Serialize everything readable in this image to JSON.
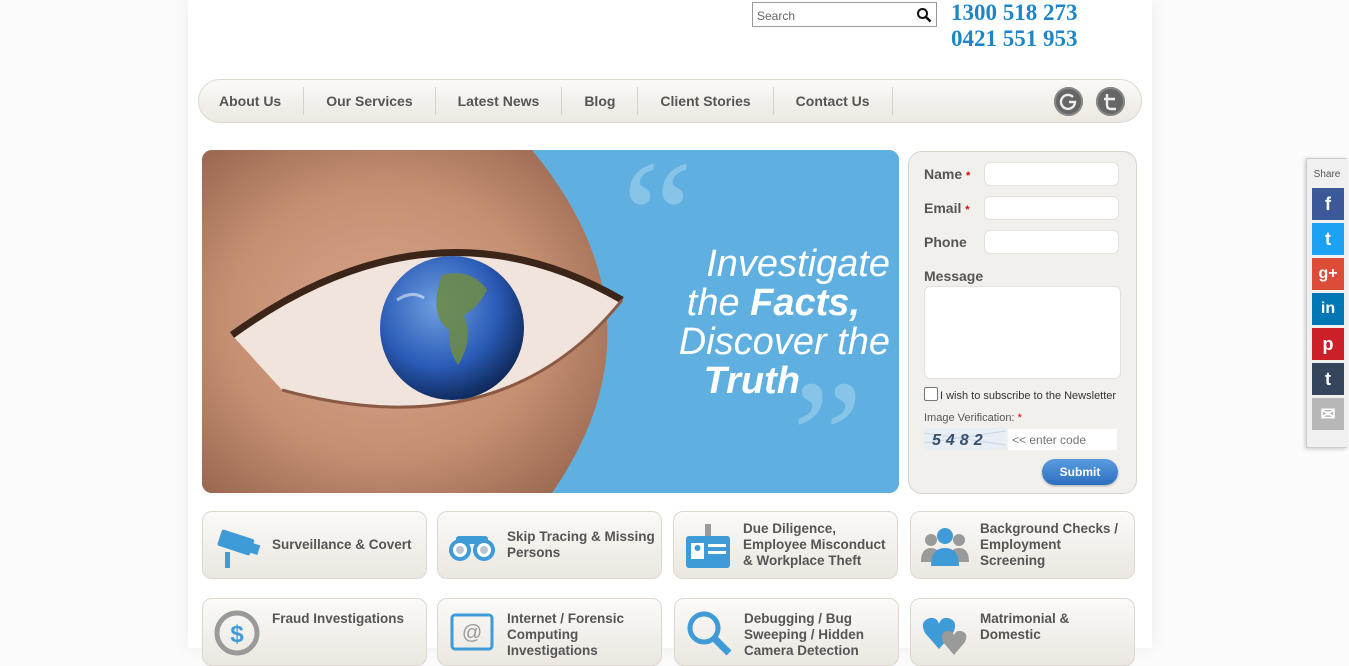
{
  "header": {
    "search_placeholder": "Search",
    "search_icon": "search-icon",
    "phone_1": "1300 518 273",
    "phone_2": "0421 551 953"
  },
  "nav": {
    "items": [
      {
        "label": "About Us"
      },
      {
        "label": "Our Services"
      },
      {
        "label": "Latest News"
      },
      {
        "label": "Blog"
      },
      {
        "label": "Client Stories"
      },
      {
        "label": "Contact Us"
      }
    ],
    "social": [
      "google-plus-icon",
      "twitter-icon"
    ]
  },
  "hero": {
    "line1": "Investigate",
    "line2_a": "the ",
    "line2_b": "Facts,",
    "line3": "Discover the",
    "line4": "Truth",
    "bg_color": "#5fb0e0"
  },
  "form": {
    "name_label": "Name",
    "email_label": "Email",
    "phone_label": "Phone",
    "message_label": "Message",
    "required_mark": "*",
    "newsletter_label": "I wish to subscribe to the Newsletter",
    "verification_label": "Image Verification:",
    "captcha_text": "5482",
    "code_placeholder": "<< enter code",
    "submit_label": "Submit"
  },
  "services": [
    {
      "label": "Surveillance & Covert",
      "icon": "camera-icon"
    },
    {
      "label": "Skip Tracing & Missing Persons",
      "icon": "binoculars-icon"
    },
    {
      "label": "Due Diligence, Employee Misconduct & Workplace Theft",
      "icon": "id-badge-icon"
    },
    {
      "label": "Background Checks / Employment Screening",
      "icon": "people-icon"
    },
    {
      "label": "Fraud Investigations",
      "icon": "dollar-icon"
    },
    {
      "label": "Internet / Forensic Computing Investigations",
      "icon": "email-at-icon"
    },
    {
      "label": "Debugging / Bug Sweeping / Hidden Camera Detection",
      "icon": "magnifier-icon"
    },
    {
      "label": "Matrimonial & Domestic",
      "icon": "hearts-icon"
    }
  ],
  "share": {
    "title": "Share",
    "buttons": [
      {
        "glyph": "f",
        "icon": "facebook-icon",
        "color": "#3b5998"
      },
      {
        "glyph": "t",
        "icon": "twitter-icon",
        "color": "#1da1f2"
      },
      {
        "glyph": "g+",
        "icon": "google-plus-icon",
        "color": "#dd4b39"
      },
      {
        "glyph": "in",
        "icon": "linkedin-icon",
        "color": "#0077b5"
      },
      {
        "glyph": "p",
        "icon": "pinterest-icon",
        "color": "#cb2027"
      },
      {
        "glyph": "t",
        "icon": "tumblr-icon",
        "color": "#35465c"
      },
      {
        "glyph": "✉",
        "icon": "email-icon",
        "color": "#b7b7b7"
      }
    ]
  }
}
